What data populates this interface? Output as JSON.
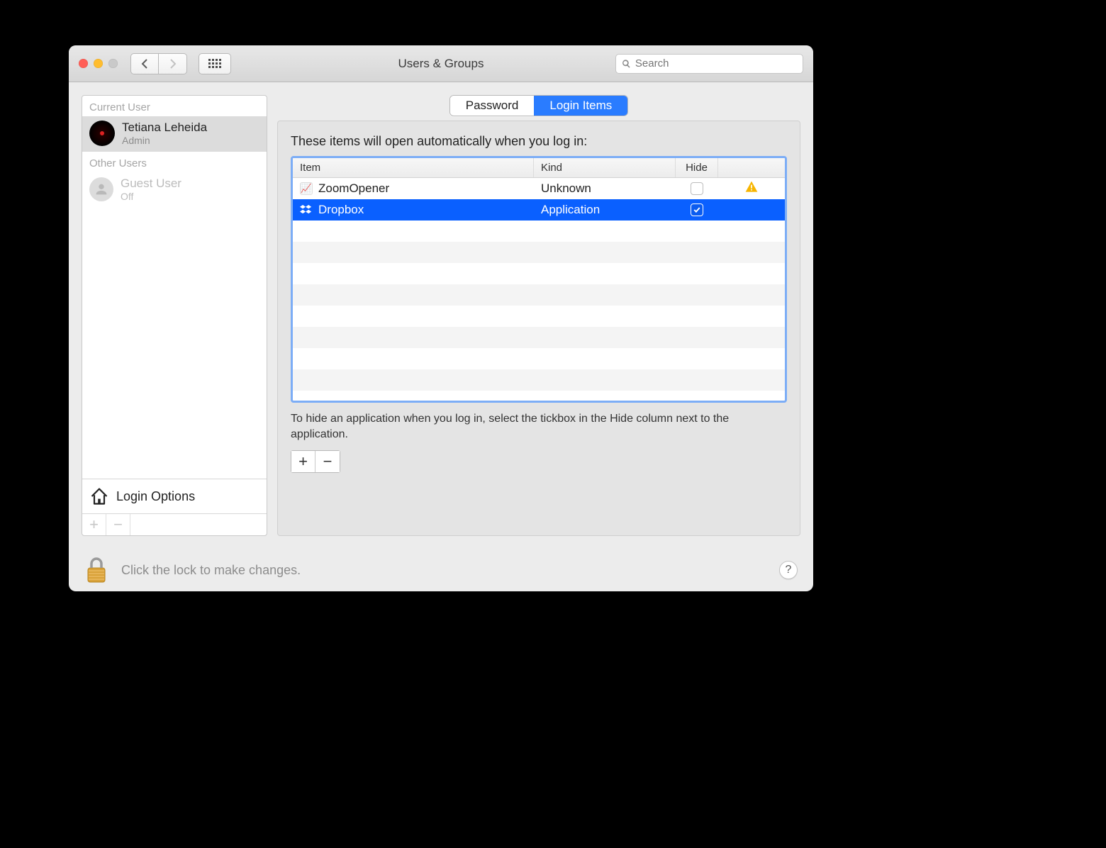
{
  "window": {
    "title": "Users & Groups"
  },
  "search": {
    "placeholder": "Search"
  },
  "sidebar": {
    "section_current": "Current User",
    "section_other": "Other Users",
    "current": {
      "name": "Tetiana Leheida",
      "role": "Admin"
    },
    "guest": {
      "name": "Guest User",
      "status": "Off"
    },
    "login_options": "Login Options"
  },
  "tabs": {
    "password": "Password",
    "login_items": "Login Items"
  },
  "panel": {
    "heading": "These items will open automatically when you log in:",
    "columns": {
      "item": "Item",
      "kind": "Kind",
      "hide": "Hide"
    },
    "rows": [
      {
        "icon": "zoom",
        "name": "ZoomOpener",
        "kind": "Unknown",
        "hide": false,
        "warning": true,
        "selected": false
      },
      {
        "icon": "dropbox",
        "name": "Dropbox",
        "kind": "Application",
        "hide": true,
        "warning": false,
        "selected": true
      }
    ],
    "hint": "To hide an application when you log in, select the tickbox in the Hide column next to the application."
  },
  "footer": {
    "lock_text": "Click the lock to make changes."
  }
}
